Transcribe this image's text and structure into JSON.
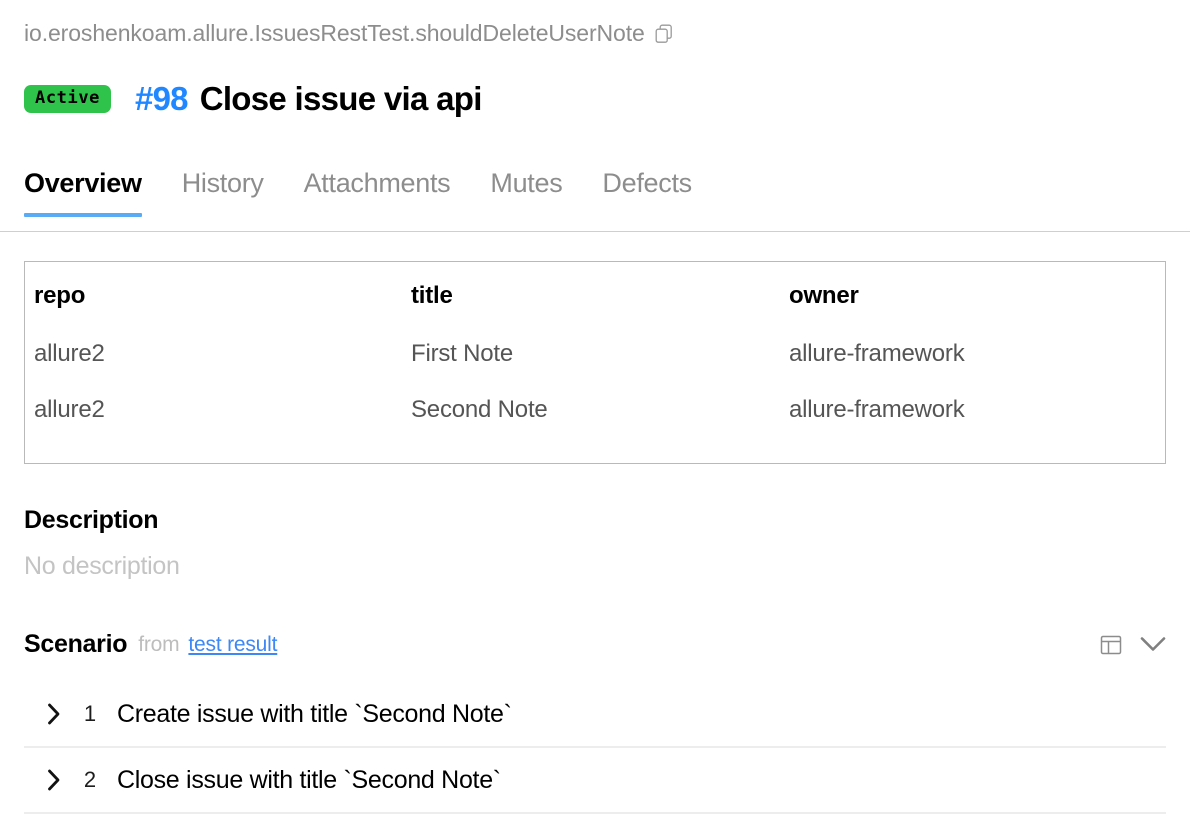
{
  "breadcrumb": {
    "path": "io.eroshenkoam.allure.IssuesRestTest.shouldDeleteUserNote",
    "copy_icon": "copy-icon"
  },
  "header": {
    "status": "Active",
    "status_color": "#2fc34b",
    "issue_number": "#98",
    "issue_number_color": "#1f87ff",
    "title": "Close issue via api"
  },
  "tabs": [
    {
      "label": "Overview",
      "active": true
    },
    {
      "label": "History",
      "active": false
    },
    {
      "label": "Attachments",
      "active": false
    },
    {
      "label": "Mutes",
      "active": false
    },
    {
      "label": "Defects",
      "active": false
    }
  ],
  "tab_accent_color": "#5aabf5",
  "table": {
    "columns": [
      "repo",
      "title",
      "owner"
    ],
    "rows": [
      [
        "allure2",
        "First Note",
        "allure-framework"
      ],
      [
        "allure2",
        "Second Note",
        "allure-framework"
      ]
    ]
  },
  "description": {
    "heading": "Description",
    "empty_text": "No description"
  },
  "scenario": {
    "heading": "Scenario",
    "from_label": "from",
    "source_link": "test result",
    "layout_icon": "layout-panel-icon",
    "collapse_icon": "chevron-down-icon",
    "steps": [
      {
        "number": "1",
        "name": "Create issue with title `Second Note`",
        "expand_icon": "chevron-right-icon"
      },
      {
        "number": "2",
        "name": "Close issue with title `Second Note`",
        "expand_icon": "chevron-right-icon"
      }
    ]
  }
}
